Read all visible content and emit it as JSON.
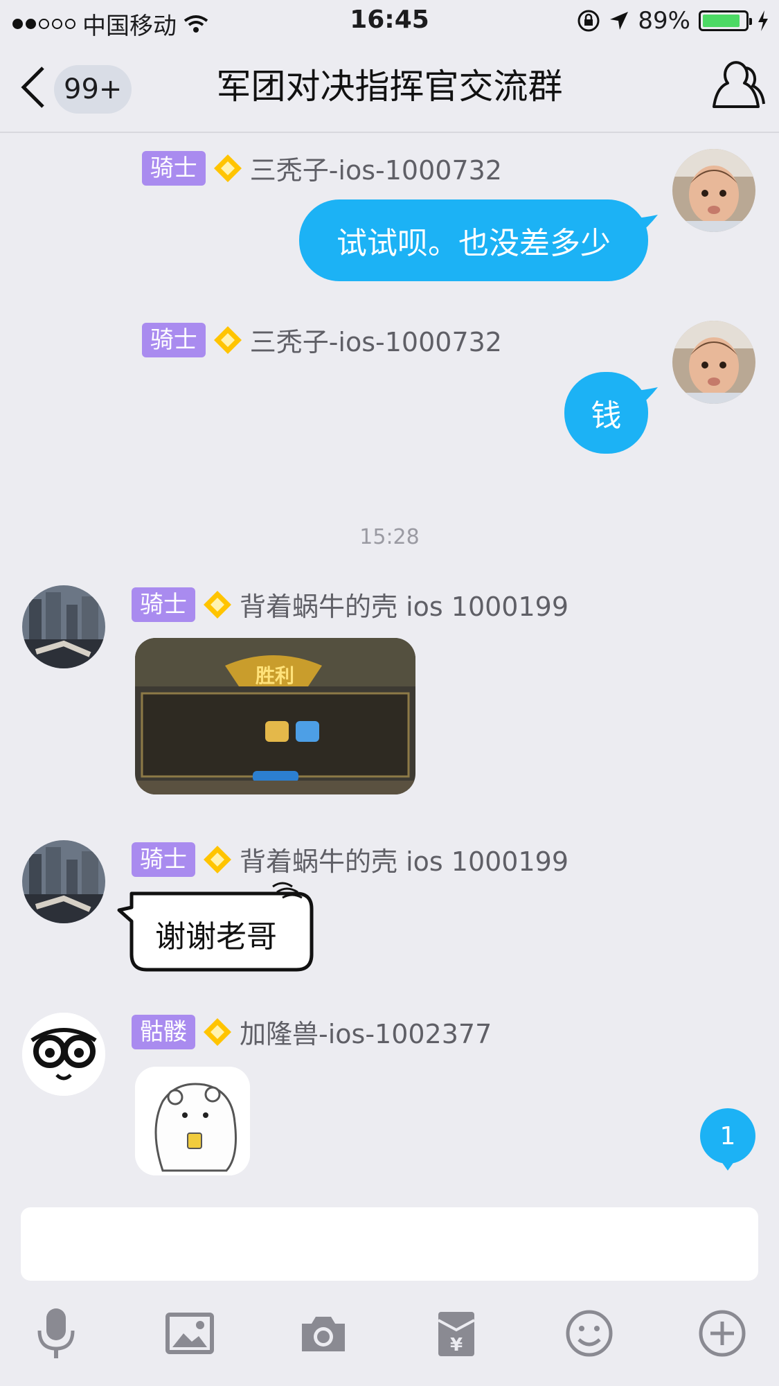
{
  "status_bar": {
    "carrier": "中国移动",
    "time": "16:45",
    "battery": "89%",
    "battery_level": 0.89
  },
  "nav": {
    "unread_count": "99+",
    "title": "军团对决指挥官交流群"
  },
  "messages": [
    {
      "sender_title": "骑士",
      "sender_name": "三秃子-ios-1000732",
      "text": "试试呗。也没差多少",
      "direction": "outgoing"
    },
    {
      "sender_title": "骑士",
      "sender_name": "三秃子-ios-1000732",
      "text": "钱",
      "direction": "outgoing"
    },
    {
      "timestamp": "15:28"
    },
    {
      "sender_title": "骑士",
      "sender_name": "背着蜗牛的壳 ios 1000199",
      "image_text": "胜利",
      "direction": "incoming"
    },
    {
      "sender_title": "骑士",
      "sender_name": "背着蜗牛的壳 ios 1000199",
      "sticker_text": "谢谢老哥",
      "direction": "incoming"
    },
    {
      "sender_title": "骷髅",
      "sender_name": "加隆兽-ios-1002377",
      "direction": "incoming"
    }
  ],
  "new_message_count": "1",
  "input": {
    "value": "",
    "placeholder": ""
  },
  "toolbar_icons": [
    "microphone-icon",
    "image-icon",
    "camera-icon",
    "red-packet-icon",
    "emoji-icon",
    "plus-icon"
  ],
  "colors": {
    "accent": "#1cb2f5",
    "title_tag": "#a98bef",
    "background": "#ececf1"
  }
}
